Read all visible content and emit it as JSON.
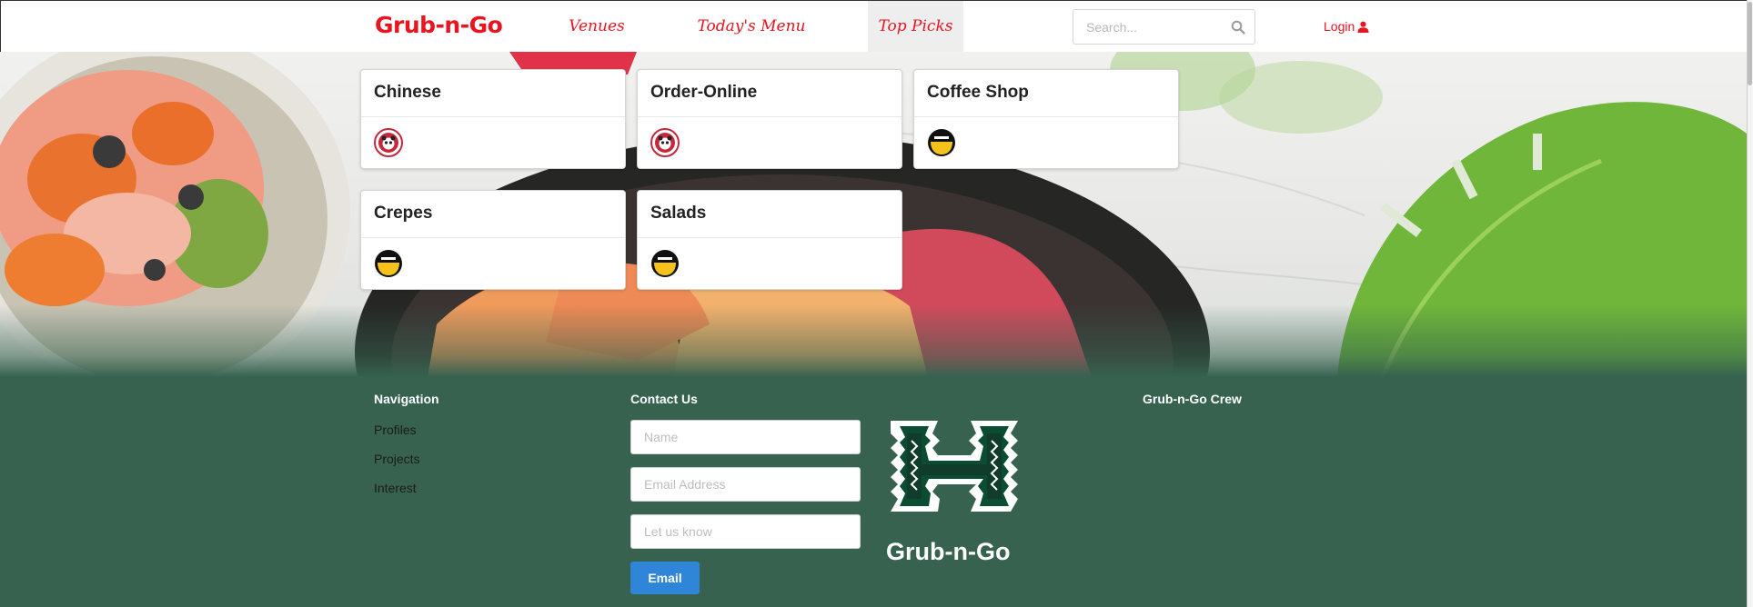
{
  "navbar": {
    "brand": "Grub-n-Go",
    "links": [
      {
        "label": "Venues"
      },
      {
        "label": "Today's Menu"
      },
      {
        "label": "Top Picks"
      }
    ],
    "search_placeholder": "Search...",
    "login_label": "Login",
    "accent_color": "#e8141f"
  },
  "cards": [
    {
      "title": "Chinese",
      "logo": "panda-express-logo"
    },
    {
      "title": "Order-Online",
      "logo": "panda-express-logo"
    },
    {
      "title": "Coffee Shop",
      "logo": "coffee-shop-logo"
    },
    {
      "title": "Crepes",
      "logo": "coffee-shop-logo"
    },
    {
      "title": "Salads",
      "logo": "coffee-shop-logo"
    }
  ],
  "footer": {
    "navigation_heading": "Navigation",
    "navigation_links": [
      "Profiles",
      "Projects",
      "Interest"
    ],
    "contact_heading": "Contact Us",
    "name_placeholder": "Name",
    "email_placeholder": "Email Address",
    "message_placeholder": "Let us know",
    "email_button": "Email",
    "brand": "Grub-n-Go",
    "crew_heading": "Grub-n-Go Crew",
    "background_color": "#36624f",
    "button_color": "#2f86d8"
  }
}
